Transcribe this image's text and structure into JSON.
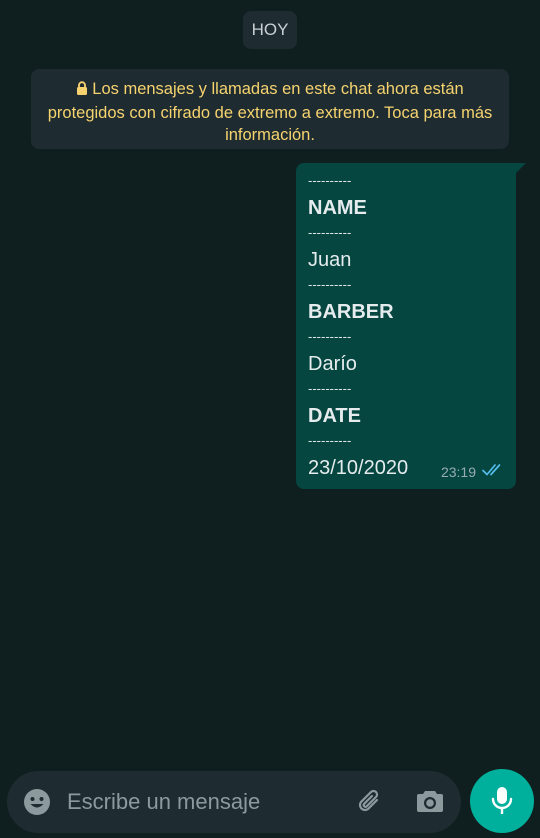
{
  "chat": {
    "date_chip": "HOY",
    "encryption_notice": "Los mensajes y llamadas en este chat ahora están protegidos con cifrado de extremo a extremo. Toca para más información.",
    "message": {
      "lines": [
        {
          "type": "separator",
          "text": "----------"
        },
        {
          "type": "label",
          "text": "NAME"
        },
        {
          "type": "separator",
          "text": "----------"
        },
        {
          "type": "value",
          "text": "Juan"
        },
        {
          "type": "separator",
          "text": "----------"
        },
        {
          "type": "label",
          "text": "BARBER"
        },
        {
          "type": "separator",
          "text": "----------"
        },
        {
          "type": "value",
          "text": "Darío"
        },
        {
          "type": "separator",
          "text": "----------"
        },
        {
          "type": "label",
          "text": "DATE"
        },
        {
          "type": "separator",
          "text": "----------"
        },
        {
          "type": "value",
          "text": "23/10/2020"
        }
      ],
      "time": "23:19",
      "status_icon": "double-check-read-icon"
    }
  },
  "composer": {
    "placeholder": "Escribe un mensaje",
    "icons": [
      "emoji-icon",
      "attach-icon",
      "camera-icon",
      "mic-icon"
    ]
  },
  "colors": {
    "background": "#0f1f1f",
    "system_bubble": "#1e2b30",
    "notice_text": "#f6d36f",
    "outgoing_bubble": "#054640",
    "read_ticks": "#53bdeb",
    "mic_button": "#00b09c"
  }
}
